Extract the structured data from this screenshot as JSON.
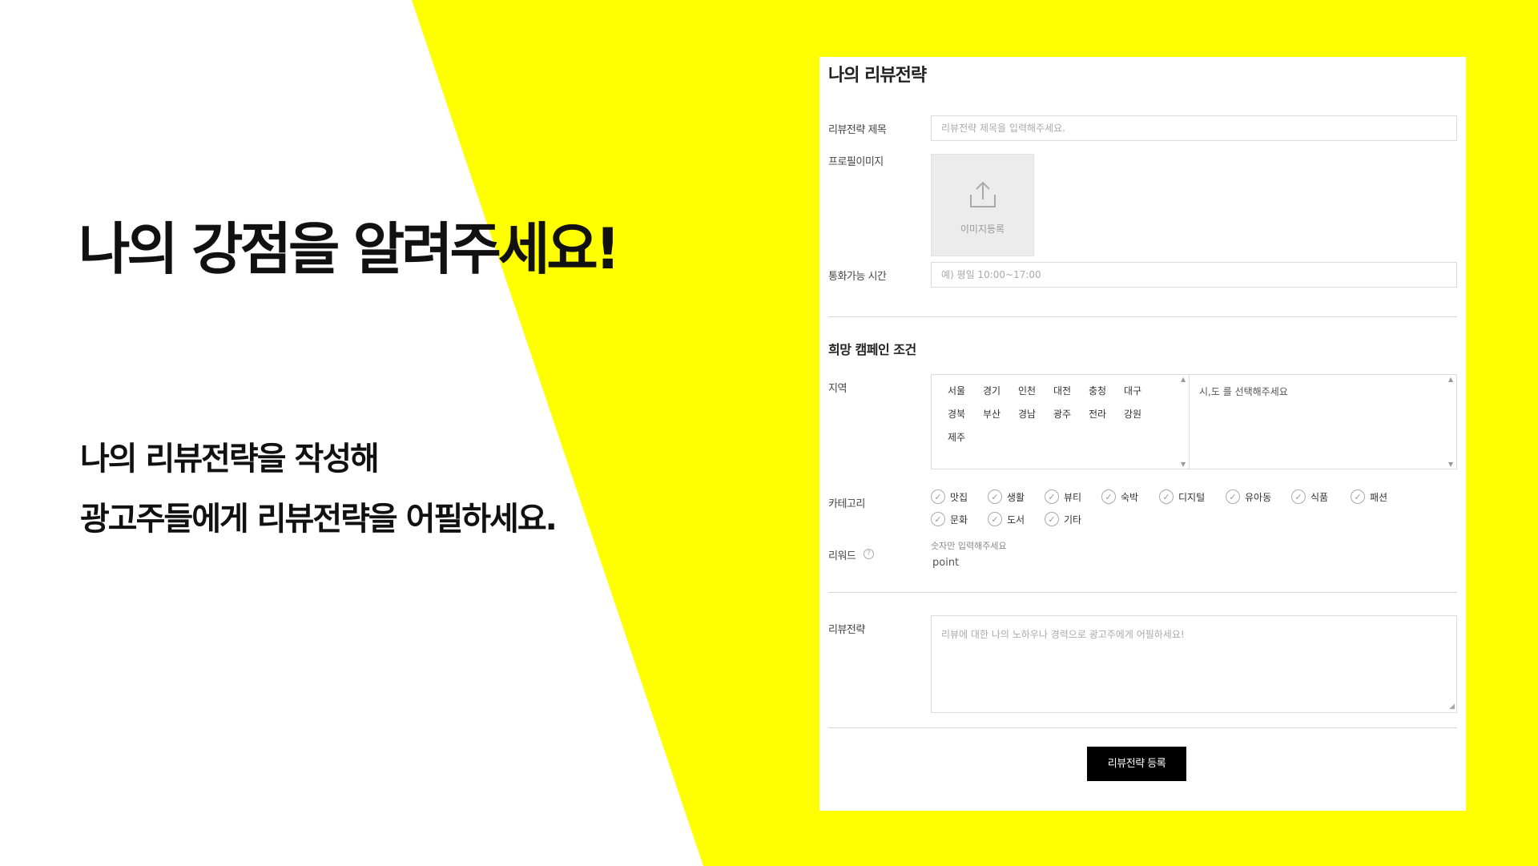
{
  "hero": {
    "headline": "나의 강점을 알려주세요!",
    "sub_line1": "나의 리뷰전략을 작성해",
    "sub_line2": "광고주들에게 리뷰전략을 어필하세요."
  },
  "form": {
    "title": "나의 리뷰전략",
    "strategy_title_label": "리뷰전략 제목",
    "strategy_title_placeholder": "리뷰전략 제목을 입력해주세요.",
    "profile_image_label": "프로필이미지",
    "upload_label": "이미지등록",
    "call_time_label": "통화가능 시간",
    "call_time_placeholder": "예) 평일 10:00~17:00",
    "campaign_section_title": "희망 캠페인 조건",
    "region_label": "지역",
    "regions": [
      "서울",
      "경기",
      "인천",
      "대전",
      "충청",
      "대구",
      "경북",
      "부산",
      "경남",
      "광주",
      "전라",
      "강원",
      "제주"
    ],
    "region_selected_placeholder": "시,도 를 선택해주세요",
    "category_label": "카테고리",
    "categories": [
      "맛집",
      "생활",
      "뷰티",
      "숙박",
      "디지털",
      "유아동",
      "식품",
      "패션",
      "문화",
      "도서",
      "기타"
    ],
    "reward_label": "리워드",
    "reward_hint": "숫자만 입력해주세요",
    "reward_value": "point",
    "strategy_label": "리뷰전략",
    "strategy_placeholder": "리뷰에 대한 나의 노하우나 경력으로 광고주에게 어필하세요!",
    "submit_label": "리뷰전략 등록"
  },
  "colors": {
    "accent_yellow": "#ffff00",
    "button_black": "#000000"
  },
  "icons": {
    "upload": "upload-icon",
    "check": "check-circle-icon",
    "help": "question-circle-icon"
  }
}
